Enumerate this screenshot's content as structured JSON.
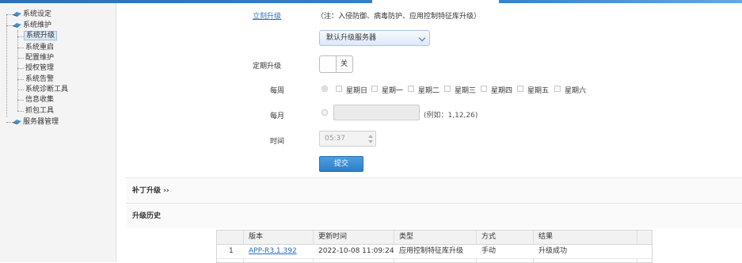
{
  "sidebar": {
    "items": [
      {
        "label": "系统设定"
      },
      {
        "label": "系统维护"
      },
      {
        "label": "系统升级"
      },
      {
        "label": "系统重启"
      },
      {
        "label": "配置维护"
      },
      {
        "label": "授权管理"
      },
      {
        "label": "系统告警"
      },
      {
        "label": "系统诊断工具"
      },
      {
        "label": "信息收集"
      },
      {
        "label": "抓包工具"
      },
      {
        "label": "服务器管理"
      }
    ]
  },
  "upgrade": {
    "upgrade_now_link": "立刻升级",
    "note": "（注：入侵防御、病毒防护、应用控制特征库升级）",
    "server_select": "默认升级服务器",
    "scheduled_label": "定期升级",
    "toggle_text": "关",
    "weekly_label": "每周",
    "days": [
      "星期日",
      "星期一",
      "星期二",
      "星期三",
      "星期四",
      "星期五",
      "星期六"
    ],
    "monthly_label": "每月",
    "monthly_hint": "(例如：1,12,26)",
    "time_label": "时间",
    "time_value": "05:37",
    "submit_label": "提交"
  },
  "patch_section": {
    "title": "补丁升级",
    "arrow": "››"
  },
  "history_section": {
    "title": "升级历史"
  },
  "history_table": {
    "headers": [
      "版本",
      "更新时间",
      "类型",
      "方式",
      "结果"
    ],
    "rows": [
      {
        "index": "1",
        "version": "APP-R3.1.392",
        "time": "2022-10-08 11:09:24",
        "type": "应用控制特征库升级",
        "method": "手动",
        "result": "升级成功"
      }
    ]
  }
}
